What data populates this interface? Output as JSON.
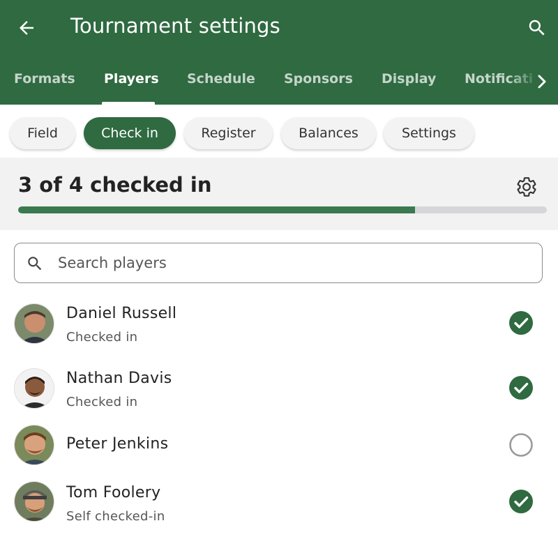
{
  "app": {
    "title": "Tournament settings",
    "back_icon": "arrow-left-icon",
    "search_icon": "search-icon",
    "accent_color": "#2f6a41"
  },
  "tabs": [
    {
      "label": "Formats"
    },
    {
      "label": "Players",
      "active": true
    },
    {
      "label": "Schedule"
    },
    {
      "label": "Sponsors"
    },
    {
      "label": "Display"
    },
    {
      "label": "Notificati"
    }
  ],
  "chips": [
    {
      "label": "Field"
    },
    {
      "label": "Check in",
      "active": true
    },
    {
      "label": "Register"
    },
    {
      "label": "Balances"
    },
    {
      "label": "Settings"
    }
  ],
  "summary": {
    "text": "3 of 4 checked in",
    "checked": 3,
    "total": 4,
    "progress_fraction": 0.75,
    "gear_icon": "gear-icon"
  },
  "search": {
    "placeholder": "Search players",
    "value": ""
  },
  "players": [
    {
      "name": "Daniel Russell",
      "status": "Checked in",
      "checked": true
    },
    {
      "name": "Nathan Davis",
      "status": "Checked in",
      "checked": true
    },
    {
      "name": "Peter Jenkins",
      "status": "",
      "checked": false
    },
    {
      "name": "Tom Foolery",
      "status": "Self checked-in",
      "checked": true
    }
  ]
}
